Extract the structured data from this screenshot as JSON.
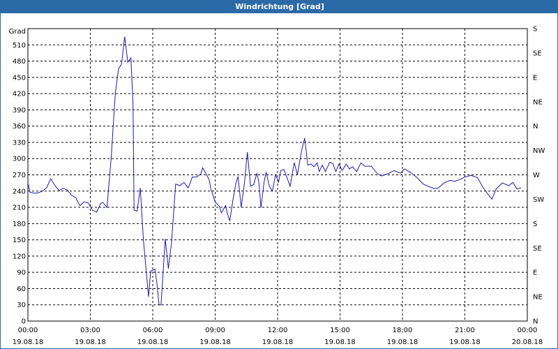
{
  "window": {
    "title": "Windrichtung [Grad]"
  },
  "chart_data": {
    "type": "line",
    "title": "Windrichtung [Grad]",
    "ylabel": "Grad",
    "ylim": [
      0,
      540
    ],
    "y_ticks": [
      0,
      30,
      60,
      90,
      120,
      150,
      180,
      210,
      240,
      270,
      300,
      330,
      360,
      390,
      420,
      450,
      480,
      510
    ],
    "right_ticks": [
      "N",
      "NE",
      "E",
      "SE",
      "S",
      "SW",
      "W",
      "NW",
      "N",
      "NE",
      "E",
      "SE",
      "S"
    ],
    "x_ticks": [
      {
        "time": "00:00",
        "date": "19.08.18"
      },
      {
        "time": "03:00",
        "date": "19.08.18"
      },
      {
        "time": "06:00",
        "date": "19.08.18"
      },
      {
        "time": "09:00",
        "date": "19.08.18"
      },
      {
        "time": "12:00",
        "date": "19.08.18"
      },
      {
        "time": "15:00",
        "date": "19.08.18"
      },
      {
        "time": "18:00",
        "date": "19.08.18"
      },
      {
        "time": "21:00",
        "date": "19.08.18"
      },
      {
        "time": "00:00",
        "date": "20.08.18"
      }
    ],
    "grid": true,
    "line_color": "#1a1aa8",
    "series": [
      {
        "points": [
          [
            0.0,
            255
          ],
          [
            0.1,
            238
          ],
          [
            0.3,
            236
          ],
          [
            0.5,
            237
          ],
          [
            0.7,
            240
          ],
          [
            0.9,
            246
          ],
          [
            1.1,
            263
          ],
          [
            1.3,
            250
          ],
          [
            1.5,
            241
          ],
          [
            1.7,
            245
          ],
          [
            1.9,
            242
          ],
          [
            2.1,
            232
          ],
          [
            2.3,
            228
          ],
          [
            2.5,
            213
          ],
          [
            2.7,
            220
          ],
          [
            2.9,
            218
          ],
          [
            3.1,
            205
          ],
          [
            3.3,
            201
          ],
          [
            3.5,
            217
          ],
          [
            3.6,
            219
          ],
          [
            3.8,
            210
          ],
          [
            4.0,
            300
          ],
          [
            4.2,
            420
          ],
          [
            4.35,
            465
          ],
          [
            4.5,
            475
          ],
          [
            4.65,
            525
          ],
          [
            4.8,
            478
          ],
          [
            4.95,
            486
          ],
          [
            5.05,
            400
          ],
          [
            5.1,
            205
          ],
          [
            5.25,
            203
          ],
          [
            5.4,
            246
          ],
          [
            5.55,
            150
          ],
          [
            5.7,
            85
          ],
          [
            5.8,
            45
          ],
          [
            5.9,
            92
          ],
          [
            6.1,
            96
          ],
          [
            6.2,
            70
          ],
          [
            6.3,
            30
          ],
          [
            6.4,
            30
          ],
          [
            6.6,
            152
          ],
          [
            6.75,
            97
          ],
          [
            6.9,
            145
          ],
          [
            7.1,
            253
          ],
          [
            7.3,
            250
          ],
          [
            7.5,
            256
          ],
          [
            7.7,
            246
          ],
          [
            7.8,
            255
          ],
          [
            7.9,
            266
          ],
          [
            8.1,
            266
          ],
          [
            8.3,
            271
          ],
          [
            8.4,
            283
          ],
          [
            8.5,
            276
          ],
          [
            8.7,
            262
          ],
          [
            8.8,
            243
          ],
          [
            9.0,
            220
          ],
          [
            9.2,
            212
          ],
          [
            9.3,
            200
          ],
          [
            9.5,
            213
          ],
          [
            9.6,
            197
          ],
          [
            9.7,
            185
          ],
          [
            9.85,
            223
          ],
          [
            10.0,
            255
          ],
          [
            10.1,
            267
          ],
          [
            10.25,
            210
          ],
          [
            10.4,
            253
          ],
          [
            10.55,
            312
          ],
          [
            10.7,
            249
          ],
          [
            10.85,
            252
          ],
          [
            11.0,
            273
          ],
          [
            11.1,
            257
          ],
          [
            11.2,
            209
          ],
          [
            11.35,
            257
          ],
          [
            11.45,
            275
          ],
          [
            11.6,
            249
          ],
          [
            11.75,
            240
          ],
          [
            11.9,
            270
          ],
          [
            12.05,
            257
          ],
          [
            12.15,
            278
          ],
          [
            12.3,
            280
          ],
          [
            12.45,
            265
          ],
          [
            12.6,
            249
          ],
          [
            12.8,
            293
          ],
          [
            12.95,
            270
          ],
          [
            13.15,
            314
          ],
          [
            13.3,
            338
          ],
          [
            13.45,
            288
          ],
          [
            13.6,
            290
          ],
          [
            13.75,
            285
          ],
          [
            13.9,
            292
          ],
          [
            14.0,
            276
          ],
          [
            14.15,
            288
          ],
          [
            14.3,
            276
          ],
          [
            14.5,
            293
          ],
          [
            14.65,
            291
          ],
          [
            14.8,
            276
          ],
          [
            14.95,
            290
          ],
          [
            15.1,
            278
          ],
          [
            15.3,
            290
          ],
          [
            15.45,
            281
          ],
          [
            15.6,
            285
          ],
          [
            15.8,
            276
          ],
          [
            16.0,
            292
          ],
          [
            16.2,
            286
          ],
          [
            16.5,
            286
          ],
          [
            16.8,
            272
          ],
          [
            17.0,
            268
          ],
          [
            17.3,
            272
          ],
          [
            17.6,
            278
          ],
          [
            17.9,
            273
          ],
          [
            18.1,
            281
          ],
          [
            18.4,
            274
          ],
          [
            18.7,
            265
          ],
          [
            19.0,
            253
          ],
          [
            19.3,
            248
          ],
          [
            19.5,
            245
          ],
          [
            19.7,
            245
          ],
          [
            20.0,
            255
          ],
          [
            20.3,
            260
          ],
          [
            20.5,
            258
          ],
          [
            20.8,
            262
          ],
          [
            21.0,
            266
          ],
          [
            21.3,
            269
          ],
          [
            21.6,
            265
          ],
          [
            21.9,
            245
          ],
          [
            22.1,
            235
          ],
          [
            22.3,
            225
          ],
          [
            22.5,
            244
          ],
          [
            22.8,
            255
          ],
          [
            23.1,
            250
          ],
          [
            23.3,
            256
          ],
          [
            23.5,
            244
          ],
          [
            23.7,
            246
          ]
        ]
      }
    ]
  }
}
